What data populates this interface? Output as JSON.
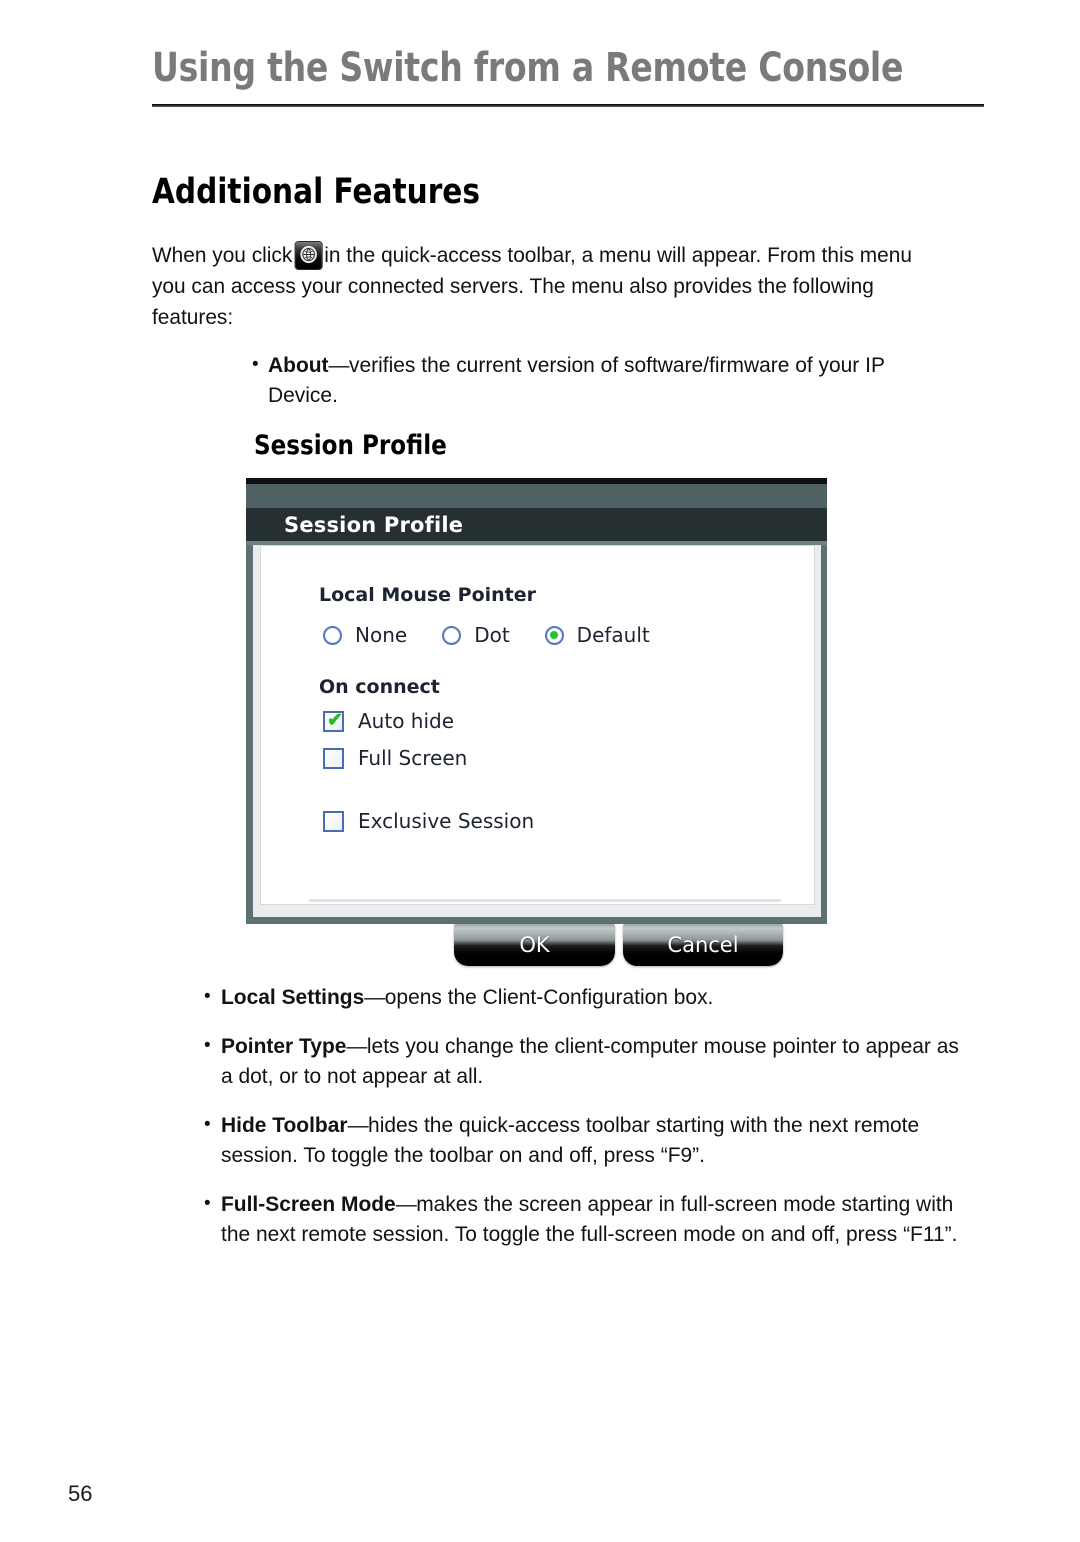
{
  "page": {
    "running_header": "Using the Switch from a Remote Console",
    "page_number": "56",
    "section_heading": "Additional Features"
  },
  "intro": {
    "before_icon": "When you click",
    "icon_name": "globe-toolbar-icon",
    "after_icon": "in the quick-access toolbar, a menu will appear. From this menu you can access your connected servers. The menu also provides the following features:"
  },
  "about_bullet": {
    "bullet_glyph": "•",
    "term": "About",
    "dash": "—",
    "description": "verifies the current version of software/firmware of your IP Device."
  },
  "sub_heading": "Session Profile",
  "dialog": {
    "title": "Session Profile",
    "local_mouse_pointer": {
      "group_label": "Local Mouse Pointer",
      "options": [
        {
          "label": "None",
          "selected": false
        },
        {
          "label": "Dot",
          "selected": false
        },
        {
          "label": "Default",
          "selected": true
        }
      ]
    },
    "on_connect": {
      "group_label": "On connect",
      "options": [
        {
          "label": "Auto hide",
          "checked": true
        },
        {
          "label": "Full Screen",
          "checked": false
        }
      ]
    },
    "exclusive_session": {
      "label": "Exclusive Session",
      "checked": false
    },
    "buttons": {
      "ok": "OK",
      "cancel": "Cancel"
    },
    "colors": {
      "titlebar_dark": "#262f31",
      "titlebar_light": "#4f6163",
      "frame": "#5d7173",
      "check_green": "#22bb22",
      "radio_blue": "#5577bb"
    }
  },
  "feature_bullets": [
    {
      "bullet_glyph": "•",
      "term": "Local Settings",
      "dash": "—",
      "description": "opens the Client-Configuration box."
    },
    {
      "bullet_glyph": "•",
      "term": "Pointer Type",
      "dash": "—",
      "description": "lets you change the client-computer mouse pointer to appear as a dot, or to not appear at all."
    },
    {
      "bullet_glyph": "•",
      "term": "Hide Toolbar",
      "dash": "—",
      "description": "hides the quick-access toolbar starting with the next remote session. To toggle the toolbar on and off, press “F9”."
    },
    {
      "bullet_glyph": "•",
      "term": "Full-Screen Mode",
      "dash": "—",
      "description": "makes the screen appear in full-screen mode starting with the next remote session. To toggle the full-screen mode on and off, press “F11”."
    }
  ]
}
